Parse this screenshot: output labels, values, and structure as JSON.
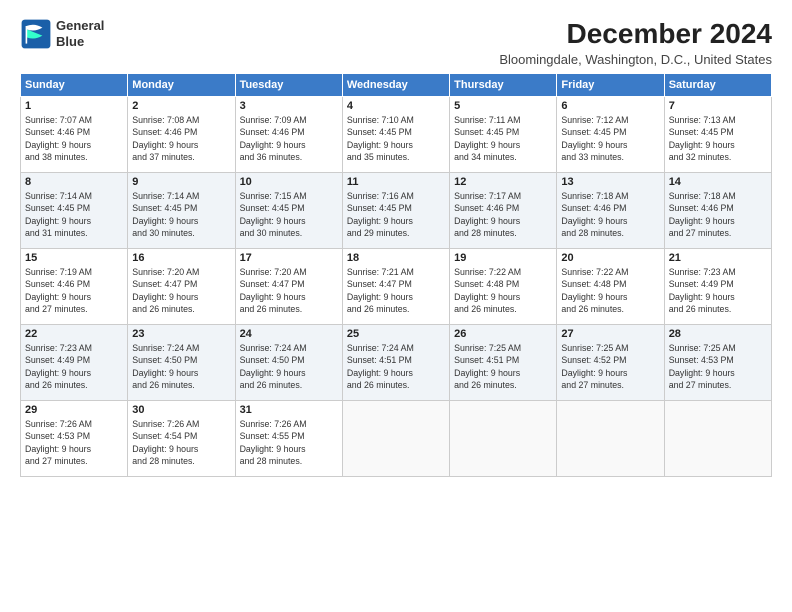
{
  "logo": {
    "line1": "General",
    "line2": "Blue"
  },
  "title": "December 2024",
  "subtitle": "Bloomingdale, Washington, D.C., United States",
  "days_of_week": [
    "Sunday",
    "Monday",
    "Tuesday",
    "Wednesday",
    "Thursday",
    "Friday",
    "Saturday"
  ],
  "weeks": [
    [
      {
        "day": "1",
        "info": "Sunrise: 7:07 AM\nSunset: 4:46 PM\nDaylight: 9 hours\nand 38 minutes."
      },
      {
        "day": "2",
        "info": "Sunrise: 7:08 AM\nSunset: 4:46 PM\nDaylight: 9 hours\nand 37 minutes."
      },
      {
        "day": "3",
        "info": "Sunrise: 7:09 AM\nSunset: 4:46 PM\nDaylight: 9 hours\nand 36 minutes."
      },
      {
        "day": "4",
        "info": "Sunrise: 7:10 AM\nSunset: 4:45 PM\nDaylight: 9 hours\nand 35 minutes."
      },
      {
        "day": "5",
        "info": "Sunrise: 7:11 AM\nSunset: 4:45 PM\nDaylight: 9 hours\nand 34 minutes."
      },
      {
        "day": "6",
        "info": "Sunrise: 7:12 AM\nSunset: 4:45 PM\nDaylight: 9 hours\nand 33 minutes."
      },
      {
        "day": "7",
        "info": "Sunrise: 7:13 AM\nSunset: 4:45 PM\nDaylight: 9 hours\nand 32 minutes."
      }
    ],
    [
      {
        "day": "8",
        "info": "Sunrise: 7:14 AM\nSunset: 4:45 PM\nDaylight: 9 hours\nand 31 minutes."
      },
      {
        "day": "9",
        "info": "Sunrise: 7:14 AM\nSunset: 4:45 PM\nDaylight: 9 hours\nand 30 minutes."
      },
      {
        "day": "10",
        "info": "Sunrise: 7:15 AM\nSunset: 4:45 PM\nDaylight: 9 hours\nand 30 minutes."
      },
      {
        "day": "11",
        "info": "Sunrise: 7:16 AM\nSunset: 4:45 PM\nDaylight: 9 hours\nand 29 minutes."
      },
      {
        "day": "12",
        "info": "Sunrise: 7:17 AM\nSunset: 4:46 PM\nDaylight: 9 hours\nand 28 minutes."
      },
      {
        "day": "13",
        "info": "Sunrise: 7:18 AM\nSunset: 4:46 PM\nDaylight: 9 hours\nand 28 minutes."
      },
      {
        "day": "14",
        "info": "Sunrise: 7:18 AM\nSunset: 4:46 PM\nDaylight: 9 hours\nand 27 minutes."
      }
    ],
    [
      {
        "day": "15",
        "info": "Sunrise: 7:19 AM\nSunset: 4:46 PM\nDaylight: 9 hours\nand 27 minutes."
      },
      {
        "day": "16",
        "info": "Sunrise: 7:20 AM\nSunset: 4:47 PM\nDaylight: 9 hours\nand 26 minutes."
      },
      {
        "day": "17",
        "info": "Sunrise: 7:20 AM\nSunset: 4:47 PM\nDaylight: 9 hours\nand 26 minutes."
      },
      {
        "day": "18",
        "info": "Sunrise: 7:21 AM\nSunset: 4:47 PM\nDaylight: 9 hours\nand 26 minutes."
      },
      {
        "day": "19",
        "info": "Sunrise: 7:22 AM\nSunset: 4:48 PM\nDaylight: 9 hours\nand 26 minutes."
      },
      {
        "day": "20",
        "info": "Sunrise: 7:22 AM\nSunset: 4:48 PM\nDaylight: 9 hours\nand 26 minutes."
      },
      {
        "day": "21",
        "info": "Sunrise: 7:23 AM\nSunset: 4:49 PM\nDaylight: 9 hours\nand 26 minutes."
      }
    ],
    [
      {
        "day": "22",
        "info": "Sunrise: 7:23 AM\nSunset: 4:49 PM\nDaylight: 9 hours\nand 26 minutes."
      },
      {
        "day": "23",
        "info": "Sunrise: 7:24 AM\nSunset: 4:50 PM\nDaylight: 9 hours\nand 26 minutes."
      },
      {
        "day": "24",
        "info": "Sunrise: 7:24 AM\nSunset: 4:50 PM\nDaylight: 9 hours\nand 26 minutes."
      },
      {
        "day": "25",
        "info": "Sunrise: 7:24 AM\nSunset: 4:51 PM\nDaylight: 9 hours\nand 26 minutes."
      },
      {
        "day": "26",
        "info": "Sunrise: 7:25 AM\nSunset: 4:51 PM\nDaylight: 9 hours\nand 26 minutes."
      },
      {
        "day": "27",
        "info": "Sunrise: 7:25 AM\nSunset: 4:52 PM\nDaylight: 9 hours\nand 27 minutes."
      },
      {
        "day": "28",
        "info": "Sunrise: 7:25 AM\nSunset: 4:53 PM\nDaylight: 9 hours\nand 27 minutes."
      }
    ],
    [
      {
        "day": "29",
        "info": "Sunrise: 7:26 AM\nSunset: 4:53 PM\nDaylight: 9 hours\nand 27 minutes."
      },
      {
        "day": "30",
        "info": "Sunrise: 7:26 AM\nSunset: 4:54 PM\nDaylight: 9 hours\nand 28 minutes."
      },
      {
        "day": "31",
        "info": "Sunrise: 7:26 AM\nSunset: 4:55 PM\nDaylight: 9 hours\nand 28 minutes."
      },
      {
        "day": "",
        "info": ""
      },
      {
        "day": "",
        "info": ""
      },
      {
        "day": "",
        "info": ""
      },
      {
        "day": "",
        "info": ""
      }
    ]
  ]
}
